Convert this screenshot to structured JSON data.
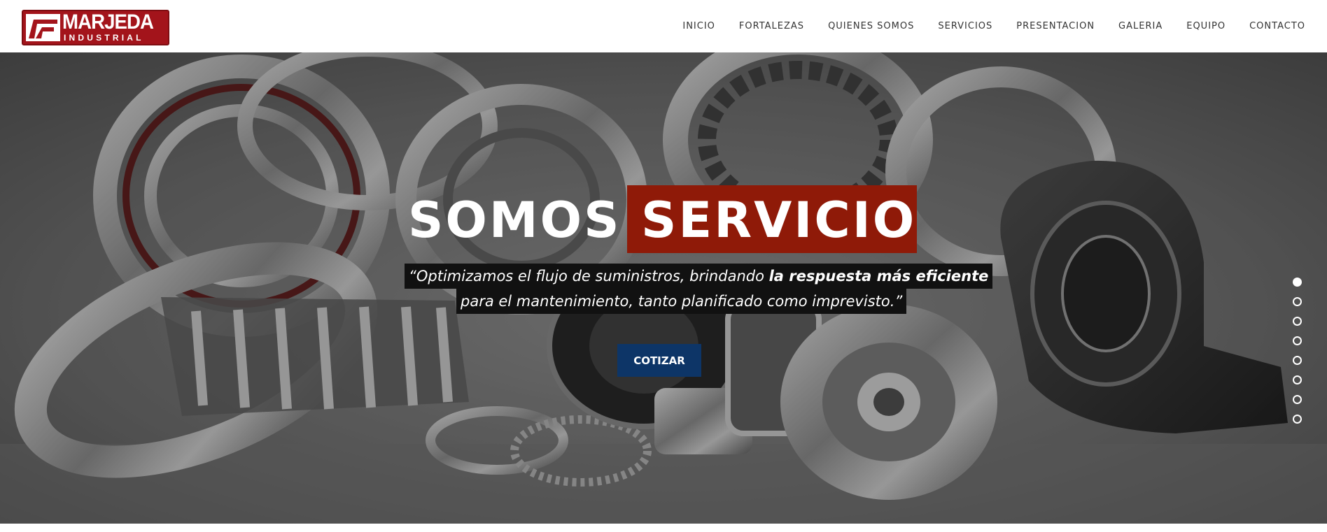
{
  "brand": {
    "name_top": "MARJEDA",
    "name_bottom": "INDUSTRIAL",
    "logo_icon": "mf-monogram-icon",
    "color": "#a3141b"
  },
  "nav": {
    "items": [
      "INICIO",
      "FORTALEZAS",
      "QUIENES SOMOS",
      "SERVICIOS",
      "PRESENTACION",
      "GALERIA",
      "EQUIPO",
      "CONTACTO"
    ]
  },
  "hero": {
    "background": "industrial bearings photo",
    "headline_plain": "SOMOS",
    "headline_highlight": "SERVICIO",
    "highlight_color": "#8f1a08",
    "quote_part1": "“Optimizamos el flujo de suministros, brindando ",
    "quote_bold": "la respuesta más eficiente",
    "quote_line2": "para el mantenimiento, tanto planificado como imprevisto.”",
    "cta_label": "COTIZAR",
    "cta_color": "#0d3567",
    "slider": {
      "total_slides": 8,
      "active_slide": 1
    }
  }
}
